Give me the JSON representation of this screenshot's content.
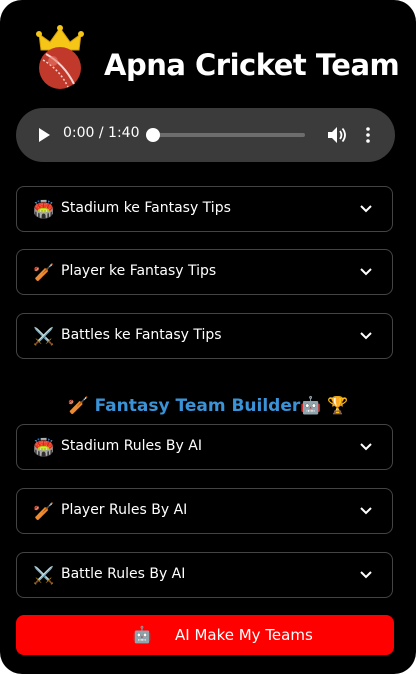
{
  "app": {
    "title": "Apna Cricket Team"
  },
  "audio": {
    "time": "0:00 / 1:40",
    "progress": 0
  },
  "tips": [
    {
      "icon": "stadium-icon",
      "emoji": "🏟️",
      "label": "Stadium ke Fantasy Tips"
    },
    {
      "icon": "cricket-bat-icon",
      "emoji": "🏏",
      "label": "Player ke Fantasy Tips"
    },
    {
      "icon": "crossed-swords-icon",
      "emoji": "⚔️",
      "label": "Battles ke Fantasy Tips"
    }
  ],
  "builder": {
    "title": "🏏 Fantasy Team Builder🤖 🏆"
  },
  "rules": [
    {
      "icon": "stadium-icon",
      "emoji": "🏟️",
      "label": "Stadium Rules By AI"
    },
    {
      "icon": "cricket-bat-icon",
      "emoji": "🏏",
      "label": "Player Rules By AI"
    },
    {
      "icon": "crossed-swords-icon",
      "emoji": "⚔️",
      "label": "Battle Rules By AI"
    }
  ],
  "cta": {
    "icon": "robot-icon",
    "emoji": "🤖",
    "label": "AI Make My Teams"
  },
  "colors": {
    "accent_blue": "#3a93d6",
    "cta_red": "#ff0000",
    "background": "#000000"
  }
}
